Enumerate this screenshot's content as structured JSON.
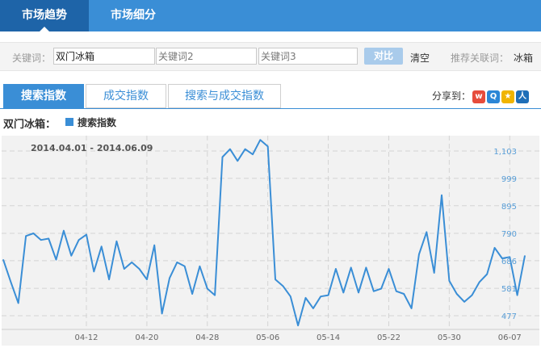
{
  "top_tabs": [
    {
      "label": "市场趋势",
      "active": true
    },
    {
      "label": "市场细分",
      "active": false
    }
  ],
  "search": {
    "keyword_label": "关键词：",
    "kw1_value": "双门冰箱",
    "kw2_placeholder": "关键词2",
    "kw3_placeholder": "关键词3",
    "compare_label": "对比",
    "clear_label": "清空",
    "recommend_label": "推荐关联词：",
    "recommend_value": "冰箱"
  },
  "sub_tabs": [
    {
      "label": "搜索指数",
      "active": true
    },
    {
      "label": "成交指数",
      "active": false
    },
    {
      "label": "搜索与成交指数",
      "active": false
    }
  ],
  "share": {
    "label": "分享到："
  },
  "legend": {
    "keyword": "双门冰箱：",
    "series_name": "搜索指数",
    "color": "#3a8ed6"
  },
  "chart_data": {
    "type": "line",
    "date_range_label": "2014.04.01 - 2014.06.09",
    "x_tick_labels": [
      "04-12",
      "04-20",
      "04-28",
      "05-06",
      "05-14",
      "05-22",
      "05-30",
      "06-07"
    ],
    "y_tick_labels": [
      "1,103",
      "999",
      "895",
      "790",
      "686",
      "581",
      "477"
    ],
    "ylim": [
      425,
      1155
    ],
    "grid": true,
    "series": [
      {
        "name": "搜索指数",
        "color": "#3a8ed6",
        "x": [
          "04-01",
          "04-02",
          "04-03",
          "04-04",
          "04-05",
          "04-06",
          "04-07",
          "04-08",
          "04-09",
          "04-10",
          "04-11",
          "04-12",
          "04-13",
          "04-14",
          "04-15",
          "04-16",
          "04-17",
          "04-18",
          "04-19",
          "04-20",
          "04-21",
          "04-22",
          "04-23",
          "04-24",
          "04-25",
          "04-26",
          "04-27",
          "04-28",
          "04-29",
          "04-30",
          "05-01",
          "05-02",
          "05-03",
          "05-04",
          "05-05",
          "05-06",
          "05-07",
          "05-08",
          "05-09",
          "05-10",
          "05-11",
          "05-12",
          "05-13",
          "05-14",
          "05-15",
          "05-16",
          "05-17",
          "05-18",
          "05-19",
          "05-20",
          "05-21",
          "05-22",
          "05-23",
          "05-24",
          "05-25",
          "05-26",
          "05-27",
          "05-28",
          "05-29",
          "05-30",
          "05-31",
          "06-01",
          "06-02",
          "06-03",
          "06-04",
          "06-05",
          "06-06",
          "06-07",
          "06-08",
          "06-09"
        ],
        "values": [
          690,
          605,
          525,
          780,
          790,
          765,
          770,
          690,
          800,
          705,
          765,
          785,
          645,
          740,
          615,
          760,
          655,
          680,
          655,
          615,
          745,
          485,
          620,
          680,
          665,
          560,
          665,
          580,
          555,
          1080,
          1110,
          1065,
          1110,
          1090,
          1145,
          1120,
          615,
          590,
          550,
          440,
          545,
          505,
          550,
          555,
          655,
          565,
          660,
          565,
          660,
          570,
          580,
          655,
          570,
          560,
          505,
          710,
          795,
          640,
          935,
          610,
          560,
          530,
          555,
          605,
          635,
          735,
          695,
          700,
          555,
          705
        ]
      }
    ]
  }
}
